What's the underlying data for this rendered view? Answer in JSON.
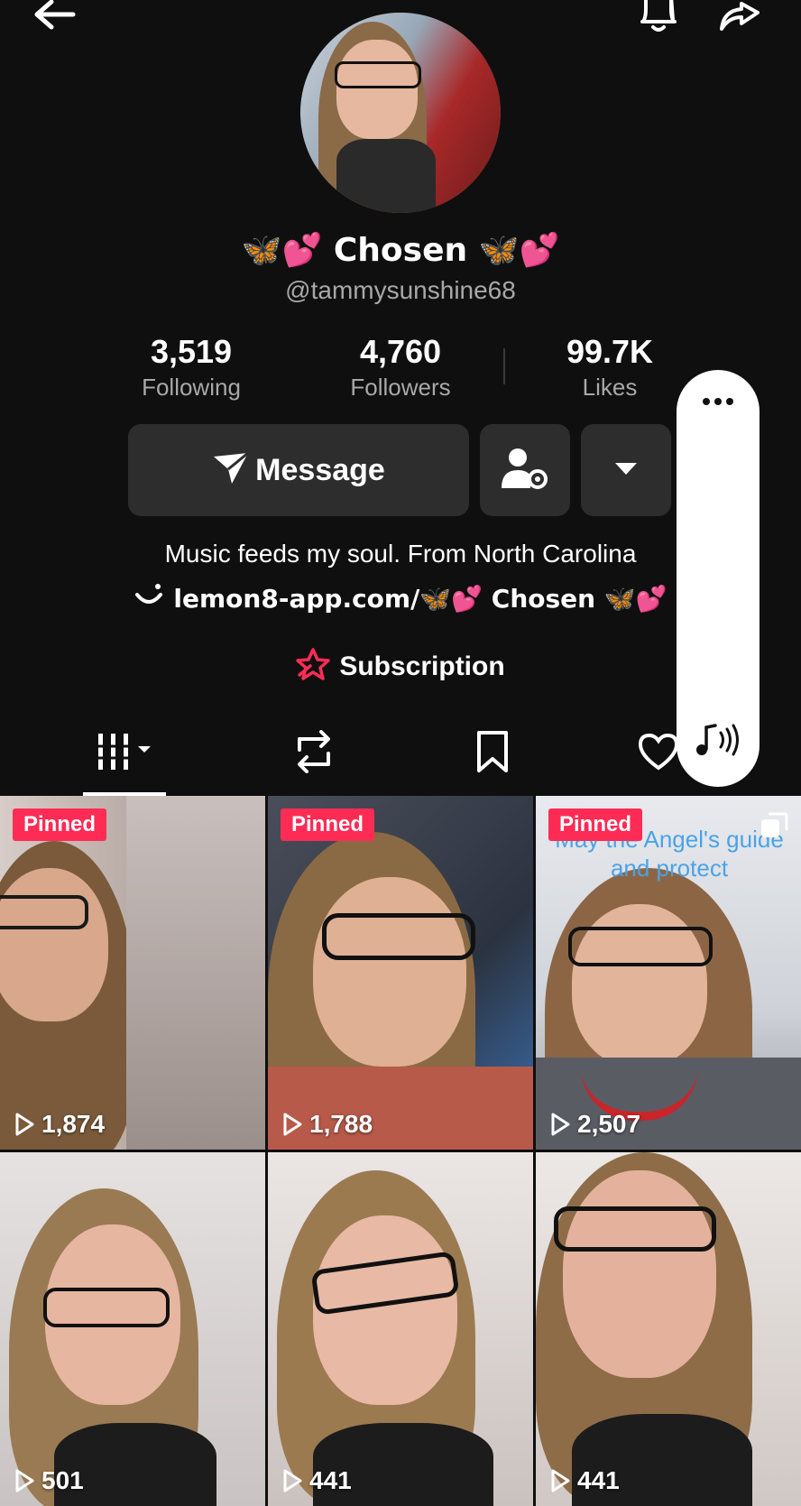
{
  "header": {
    "back_icon": "arrow-left-icon",
    "bell_icon": "bell-icon",
    "share_icon": "share-arrow-icon"
  },
  "profile": {
    "display_name": "🦋💕 Chosen 🦋💕",
    "handle": "@tammysunshine68"
  },
  "stats": [
    {
      "value": "3,519",
      "label": "Following"
    },
    {
      "value": "4,760",
      "label": "Followers"
    },
    {
      "value": "99.7K",
      "label": "Likes"
    }
  ],
  "actions": {
    "message_label": "Message",
    "friends_icon": "person-settings-icon",
    "dropdown_icon": "caret-down-icon"
  },
  "bio": {
    "line1": "Music feeds my soul.  From North Carolina",
    "link": "lemon8-app.com/🦋💕 Chosen 🦋💕"
  },
  "subscription": {
    "label": "Subscription"
  },
  "tabs": [
    "videos-grid-icon",
    "repost-icon",
    "bookmark-icon",
    "liked-icon"
  ],
  "videos": [
    {
      "pinned": "Pinned",
      "views": "1,874",
      "overlay": ""
    },
    {
      "pinned": "Pinned",
      "views": "1,788",
      "overlay": ""
    },
    {
      "pinned": "Pinned",
      "views": "2,507",
      "overlay": "May the Angel's guide and protect"
    },
    {
      "pinned": "",
      "views": "501",
      "overlay": ""
    },
    {
      "pinned": "",
      "views": "441",
      "overlay": ""
    },
    {
      "pinned": "",
      "views": "441",
      "overlay": ""
    }
  ],
  "floating_panel": {
    "more_icon": "more-dots-icon",
    "sound_icon": "music-sound-icon"
  },
  "colors": {
    "accent": "#fe2c55",
    "background": "#0f0f0f",
    "button": "#2d2d2d",
    "overlay_text": "#4aa3e8"
  }
}
